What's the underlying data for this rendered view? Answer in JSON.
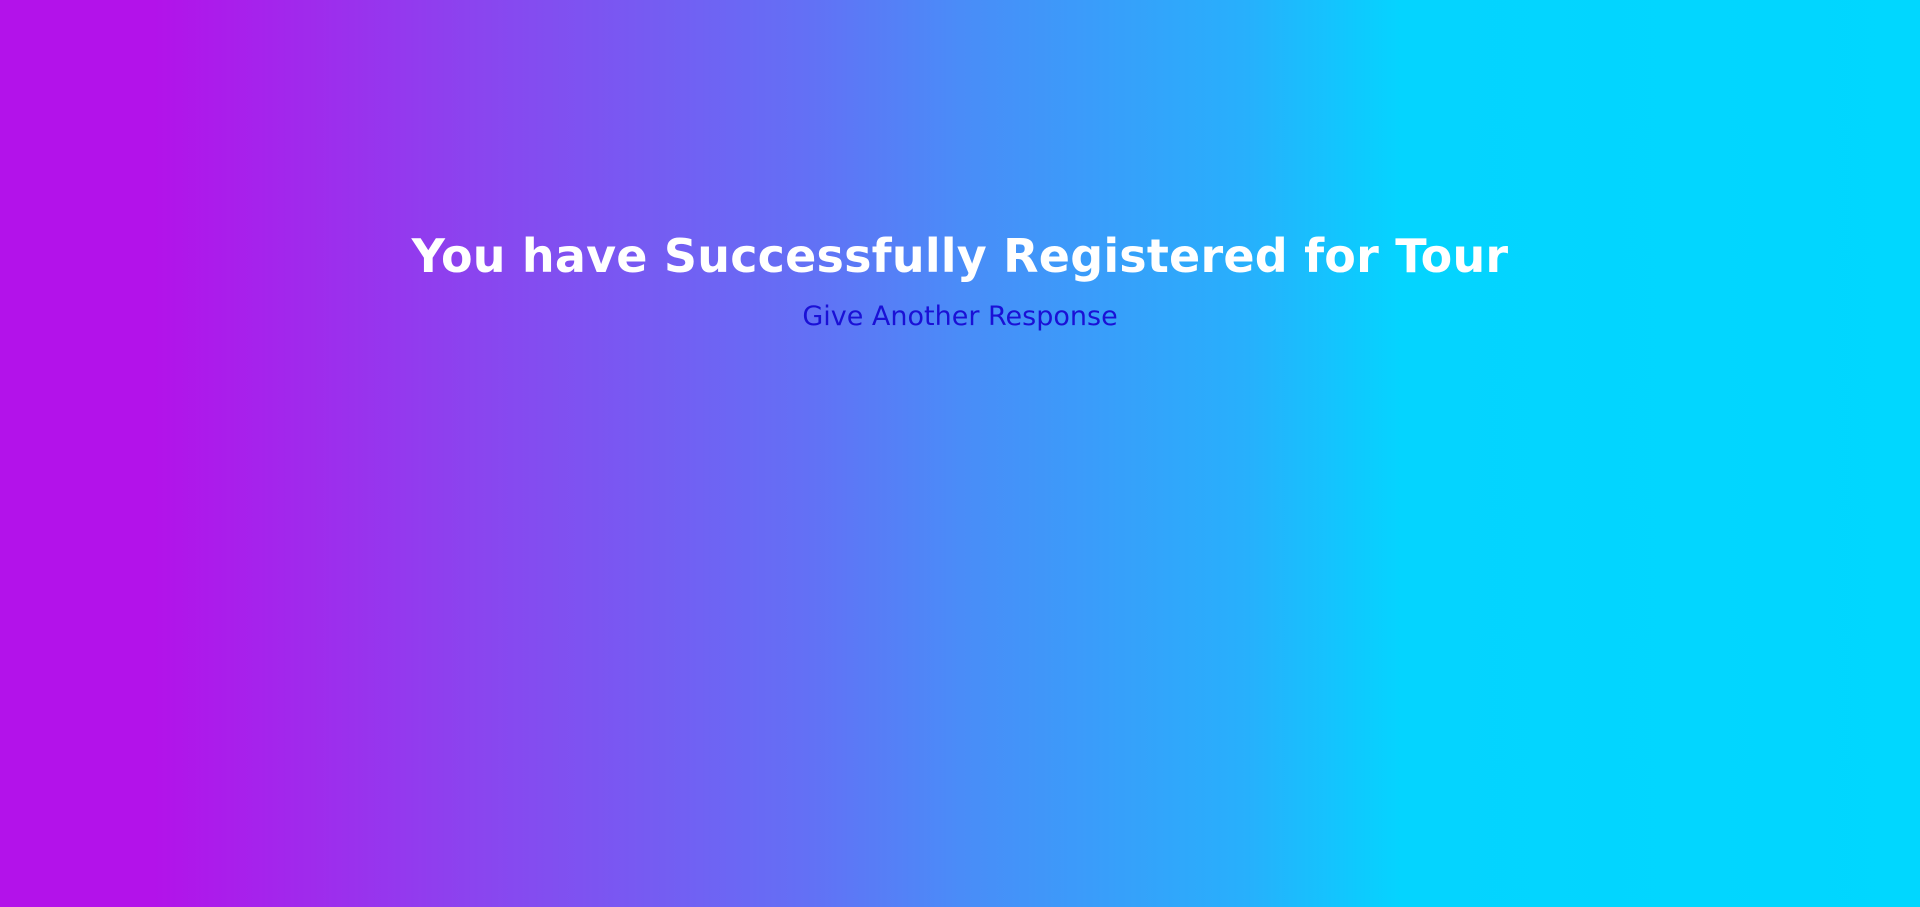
{
  "confirmation": {
    "headline": "You have Successfully Registered for Tour",
    "another_response_label": "Give Another Response"
  },
  "colors": {
    "gradient_start": "#b312ea",
    "gradient_end": "#00d7ff",
    "headline_text": "#ffffff",
    "link_text": "#1a10d6"
  }
}
